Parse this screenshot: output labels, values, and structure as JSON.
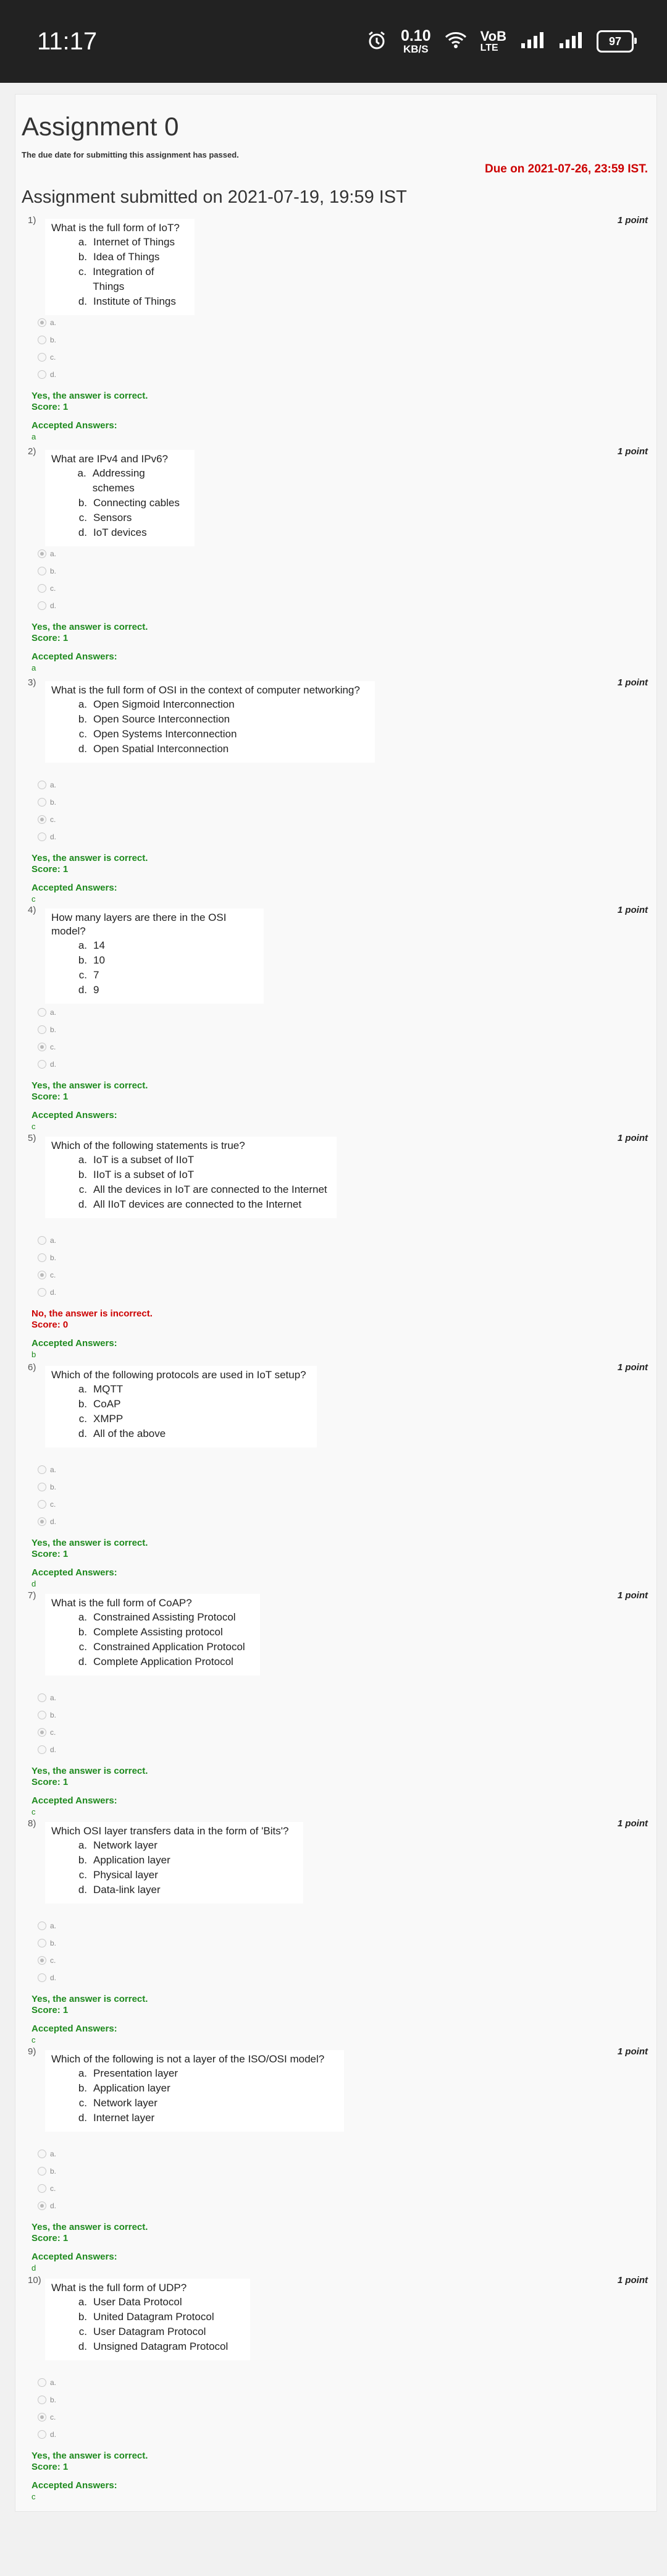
{
  "statusbar": {
    "time": "11:17",
    "speed_value": "0.10",
    "speed_unit": "KB/S",
    "volte_top": "VoB",
    "volte_bottom": "LTE",
    "battery": "97"
  },
  "assignment": {
    "title": "Assignment 0",
    "deadline_note": "The due date for submitting this assignment has passed.",
    "due": "Due on 2021-07-26, 23:59 IST.",
    "submitted": "Assignment submitted on 2021-07-19, 19:59 IST"
  },
  "labels": {
    "point": "1 point",
    "accepted": "Accepted Answers:"
  },
  "questions": [
    {
      "num": "1)",
      "text": "What is the full form of IoT?",
      "options": [
        {
          "l": "a.",
          "t": "Internet of Things"
        },
        {
          "l": "b.",
          "t": "Idea of Things"
        },
        {
          "l": "c.",
          "t": "Integration of Things"
        },
        {
          "l": "d.",
          "t": "Institute of Things"
        }
      ],
      "radios": [
        "a.",
        "b.",
        "c.",
        "d."
      ],
      "selected": 0,
      "feedback": "Yes, the answer is correct.",
      "score": "Score: 1",
      "correct": true,
      "accepted": "a"
    },
    {
      "num": "2)",
      "text": "What are IPv4 and IPv6?",
      "options": [
        {
          "l": "a.",
          "t": "Addressing schemes"
        },
        {
          "l": "b.",
          "t": "Connecting cables"
        },
        {
          "l": "c.",
          "t": "Sensors"
        },
        {
          "l": "d.",
          "t": "IoT devices"
        }
      ],
      "radios": [
        "a.",
        "b.",
        "c.",
        "d."
      ],
      "selected": 0,
      "feedback": "Yes, the answer is correct.",
      "score": "Score: 1",
      "correct": true,
      "accepted": "a"
    },
    {
      "num": "3)",
      "text": "What is the full form of OSI in the context of computer networking?",
      "options": [
        {
          "l": "a.",
          "t": "Open Sigmoid Interconnection"
        },
        {
          "l": "b.",
          "t": "Open Source Interconnection"
        },
        {
          "l": "c.",
          "t": "Open Systems Interconnection"
        },
        {
          "l": "d.",
          "t": "Open Spatial Interconnection"
        }
      ],
      "radios": [
        "a.",
        "b.",
        "c.",
        "d."
      ],
      "selected": 2,
      "feedback": "Yes, the answer is correct.",
      "score": "Score: 1",
      "correct": true,
      "accepted": "c"
    },
    {
      "num": "4)",
      "text": "How many layers are there in the OSI model?",
      "options": [
        {
          "l": "a.",
          "t": "14"
        },
        {
          "l": "b.",
          "t": "10"
        },
        {
          "l": "c.",
          "t": "7"
        },
        {
          "l": "d.",
          "t": "9"
        }
      ],
      "radios": [
        "a.",
        "b.",
        "c.",
        "d."
      ],
      "selected": 2,
      "feedback": "Yes, the answer is correct.",
      "score": "Score: 1",
      "correct": true,
      "accepted": "c"
    },
    {
      "num": "5)",
      "text": "Which of the following statements is true?",
      "options": [
        {
          "l": "a.",
          "t": "IoT is a subset of IIoT"
        },
        {
          "l": "b.",
          "t": "IIoT is a subset of IoT"
        },
        {
          "l": "c.",
          "t": "All the devices in IoT are connected to the Internet"
        },
        {
          "l": "d.",
          "t": "All IIoT devices are connected to the Internet"
        }
      ],
      "radios": [
        "a.",
        "b.",
        "c.",
        "d."
      ],
      "selected": 2,
      "feedback": "No, the answer is incorrect.",
      "score": "Score: 0",
      "correct": false,
      "accepted": "b"
    },
    {
      "num": "6)",
      "text": "Which of the following protocols are used in IoT setup?",
      "options": [
        {
          "l": "a.",
          "t": "MQTT"
        },
        {
          "l": "b.",
          "t": "CoAP"
        },
        {
          "l": "c.",
          "t": "XMPP"
        },
        {
          "l": "d.",
          "t": "All of the above"
        }
      ],
      "radios": [
        "a.",
        "b.",
        "c.",
        "d."
      ],
      "selected": 3,
      "feedback": "Yes, the answer is correct.",
      "score": "Score: 1",
      "correct": true,
      "accepted": "d"
    },
    {
      "num": "7)",
      "text": "What is the full form of CoAP?",
      "options": [
        {
          "l": "a.",
          "t": "Constrained Assisting Protocol"
        },
        {
          "l": "b.",
          "t": "Complete Assisting protocol"
        },
        {
          "l": "c.",
          "t": "Constrained Application Protocol"
        },
        {
          "l": "d.",
          "t": "Complete Application Protocol"
        }
      ],
      "radios": [
        "a.",
        "b.",
        "c.",
        "d."
      ],
      "selected": 2,
      "feedback": "Yes, the answer is correct.",
      "score": "Score: 1",
      "correct": true,
      "accepted": "c"
    },
    {
      "num": "8)",
      "text": "Which OSI layer transfers data in the form of 'Bits'?",
      "options": [
        {
          "l": "a.",
          "t": "Network layer"
        },
        {
          "l": "b.",
          "t": "Application layer"
        },
        {
          "l": "c.",
          "t": "Physical layer"
        },
        {
          "l": "d.",
          "t": "Data-link layer"
        }
      ],
      "radios": [
        "a.",
        "b.",
        "c.",
        "d."
      ],
      "selected": 2,
      "feedback": "Yes, the answer is correct.",
      "score": "Score: 1",
      "correct": true,
      "accepted": "c"
    },
    {
      "num": "9)",
      "text": "Which of the following is not a layer of the ISO/OSI model?",
      "options": [
        {
          "l": "a.",
          "t": "Presentation layer"
        },
        {
          "l": "b.",
          "t": "Application layer"
        },
        {
          "l": "c.",
          "t": "Network layer"
        },
        {
          "l": "d.",
          "t": "Internet layer"
        }
      ],
      "radios": [
        "a.",
        "b.",
        "c.",
        "d."
      ],
      "selected": 3,
      "feedback": "Yes, the answer is correct.",
      "score": "Score: 1",
      "correct": true,
      "accepted": "d"
    },
    {
      "num": "10)",
      "text": "What is the full form of UDP?",
      "options": [
        {
          "l": "a.",
          "t": "User Data Protocol"
        },
        {
          "l": "b.",
          "t": "United Datagram Protocol"
        },
        {
          "l": "c.",
          "t": "User Datagram Protocol"
        },
        {
          "l": "d.",
          "t": "Unsigned Datagram Protocol"
        }
      ],
      "radios": [
        "a.",
        "b.",
        "c.",
        "d."
      ],
      "selected": 2,
      "feedback": "Yes, the answer is correct.",
      "score": "Score: 1",
      "correct": true,
      "accepted": "c"
    }
  ]
}
